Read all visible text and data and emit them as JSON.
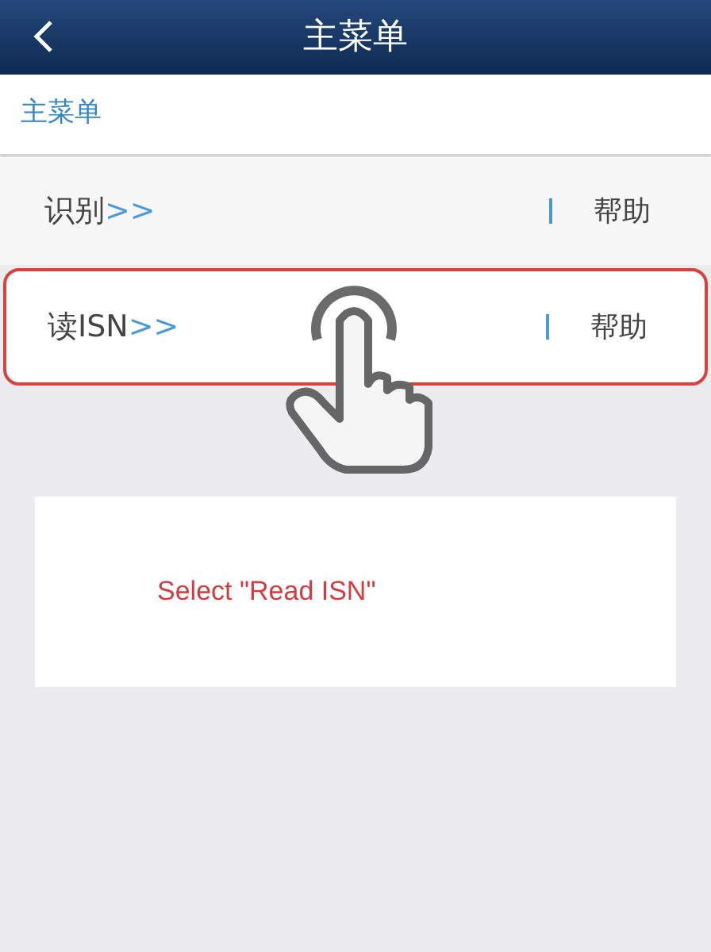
{
  "header": {
    "title": "主菜单"
  },
  "breadcrumb": "主菜单",
  "menu_items": [
    {
      "label": "识别",
      "arrow": ">>",
      "help": "帮助",
      "highlighted": false
    },
    {
      "label": "读ISN",
      "arrow": ">>",
      "help": "帮助",
      "highlighted": true
    }
  ],
  "caption": "Select \"Read ISN\""
}
